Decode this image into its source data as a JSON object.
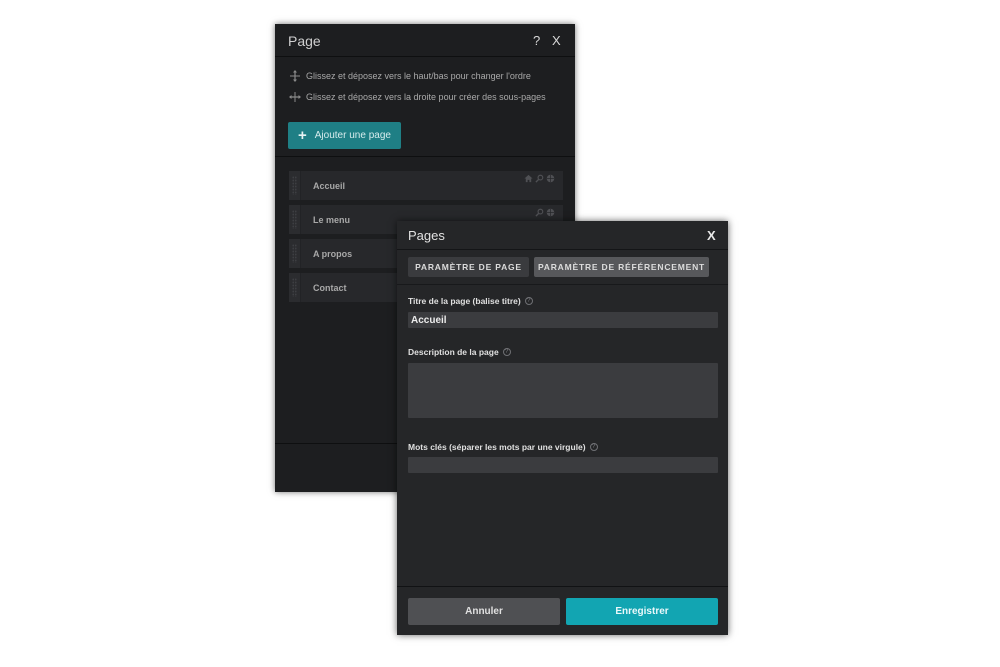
{
  "page_panel": {
    "title": "Page",
    "help_label": "?",
    "close_label": "X",
    "hints": [
      {
        "icon": "move-vertical-icon",
        "text": "Glissez et déposez vers le haut/bas pour changer l'ordre"
      },
      {
        "icon": "move-horizontal-icon",
        "text": "Glissez et déposez vers la droite pour créer des sous-pages"
      }
    ],
    "add_button": {
      "icon": "plus-icon",
      "label": "Ajouter une page"
    },
    "pages": [
      {
        "label": "Accueil",
        "icons": [
          "home-icon",
          "search-icon",
          "globe-icon"
        ]
      },
      {
        "label": "Le menu",
        "icons": [
          "search-icon",
          "globe-icon"
        ]
      },
      {
        "label": "A propos",
        "icons": []
      },
      {
        "label": "Contact",
        "icons": []
      }
    ]
  },
  "pages_dialog": {
    "title": "Pages",
    "close_label": "X",
    "tabs": [
      {
        "label": "PARAMÈTRE DE PAGE",
        "active": false
      },
      {
        "label": "PARAMÈTRE DE RÉFÉRENCEMENT",
        "active": true
      }
    ],
    "fields": {
      "title": {
        "label": "Titre de la page (balise titre)",
        "value": "Accueil"
      },
      "description": {
        "label": "Description de la page",
        "value": ""
      },
      "keywords": {
        "label": "Mots clés (séparer les mots par une virgule)",
        "value": ""
      }
    },
    "help_glyph": "?",
    "cancel_label": "Annuler",
    "save_label": "Enregistrer"
  },
  "colors": {
    "accent": "#12a5b2",
    "add_button": "#1f7f85",
    "panel_bg": "#1d1e20",
    "dialog_bg": "#252628"
  }
}
